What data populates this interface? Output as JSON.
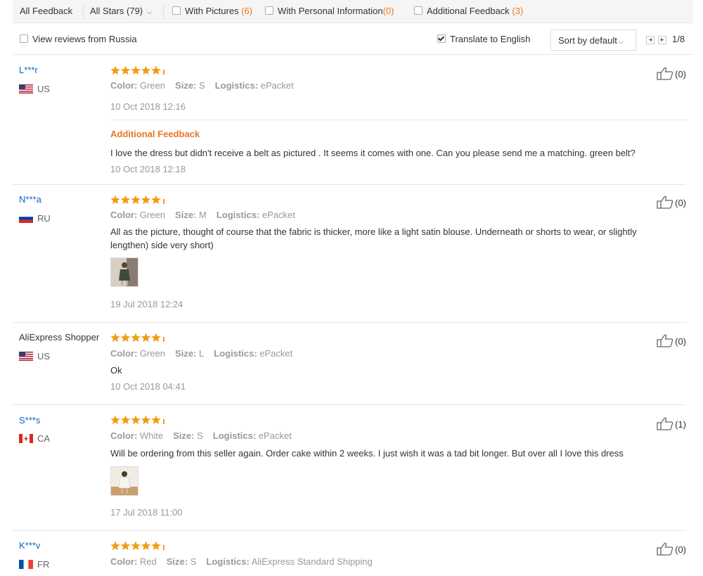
{
  "filters": {
    "all_feedback": "All Feedback",
    "all_stars": "All Stars (79)",
    "with_pictures": "With Pictures",
    "with_pictures_count": "(6)",
    "with_personal": "With Personal Information",
    "with_personal_count": "(0)",
    "additional": "Additional Feedback",
    "additional_count": "(3)"
  },
  "options": {
    "view_russia": "View reviews from Russia",
    "translate": "Translate to English",
    "sort": "Sort by default",
    "page": "1/8"
  },
  "labels": {
    "color": "Color:",
    "size": "Size:",
    "logistics": "Logistics:",
    "additional_feedback": "Additional Feedback"
  },
  "reviews": [
    {
      "user": "L***r",
      "country": "US",
      "color": "Green",
      "size": "S",
      "logistics": "ePacket",
      "date": "10 Oct 2018 12:16",
      "helpful": "(0)",
      "rating": 5,
      "additional_text": "I love the dress but didn't receive a belt as pictured . It seems it comes with one. Can you please send me a matching. green belt?",
      "additional_date": "10 Oct 2018 12:18"
    },
    {
      "user": "N***a",
      "country": "RU",
      "color": "Green",
      "size": "M",
      "logistics": "ePacket",
      "text": "All as the picture, thought of course that the fabric is thicker, more like a light satin blouse. Underneath or shorts to wear, or slightly lengthen) side very short)",
      "date": "19 Jul 2018 12:24",
      "helpful": "(0)",
      "rating": 5
    },
    {
      "user": "AliExpress Shopper",
      "country": "US",
      "color": "Green",
      "size": "L",
      "logistics": "ePacket",
      "text": "Ok",
      "date": "10 Oct 2018 04:41",
      "helpful": "(0)",
      "rating": 5
    },
    {
      "user": "S***s",
      "country": "CA",
      "color": "White",
      "size": "S",
      "logistics": "ePacket",
      "text": "Will be ordering from this seller again. Order cake within 2 weeks. I just wish it was a tad bit longer. But over all I love this dress",
      "date": "17 Jul 2018 11:00",
      "helpful": "(1)",
      "rating": 5
    },
    {
      "user": "K***v",
      "country": "FR",
      "color": "Red",
      "size": "S",
      "logistics": "AliExpress Standard Shipping",
      "helpful": "(0)",
      "rating": 5
    }
  ],
  "colors": {
    "accent": "#e87722",
    "link": "#0b63ce",
    "star": "#f39c12"
  }
}
